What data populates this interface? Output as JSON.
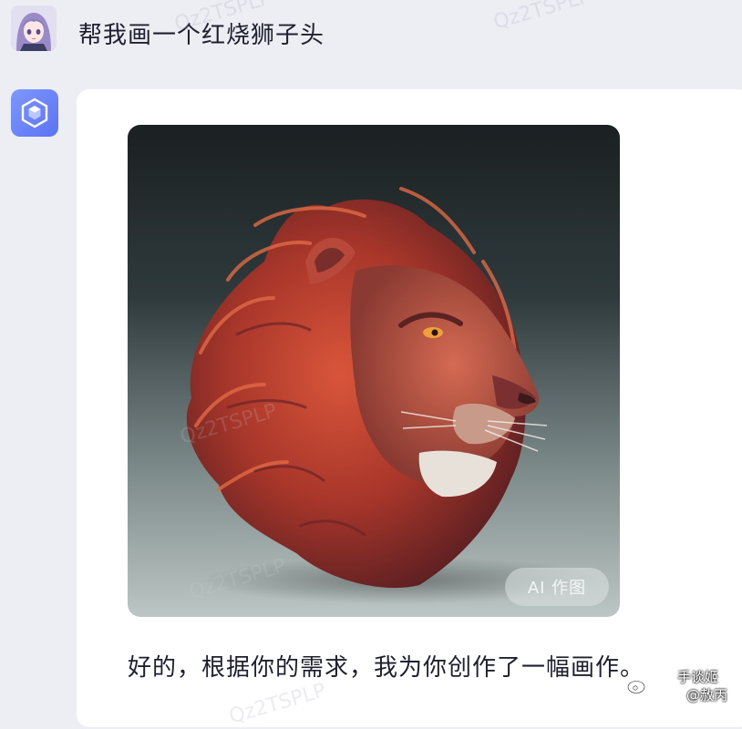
{
  "user_message": {
    "text": "帮我画一个红烧狮子头"
  },
  "bot_message": {
    "reply_text": "好的，根据你的需求，我为你创作了一幅画作。",
    "image_badge": "AI 作图"
  },
  "watermark": {
    "text": "Qz2TSPLP"
  },
  "weibo_watermark": {
    "line1": "手谈姬",
    "line2": "@赦丙"
  },
  "colors": {
    "bot_avatar": "#6b84fa",
    "background": "#eceef4",
    "card": "#ffffff"
  }
}
